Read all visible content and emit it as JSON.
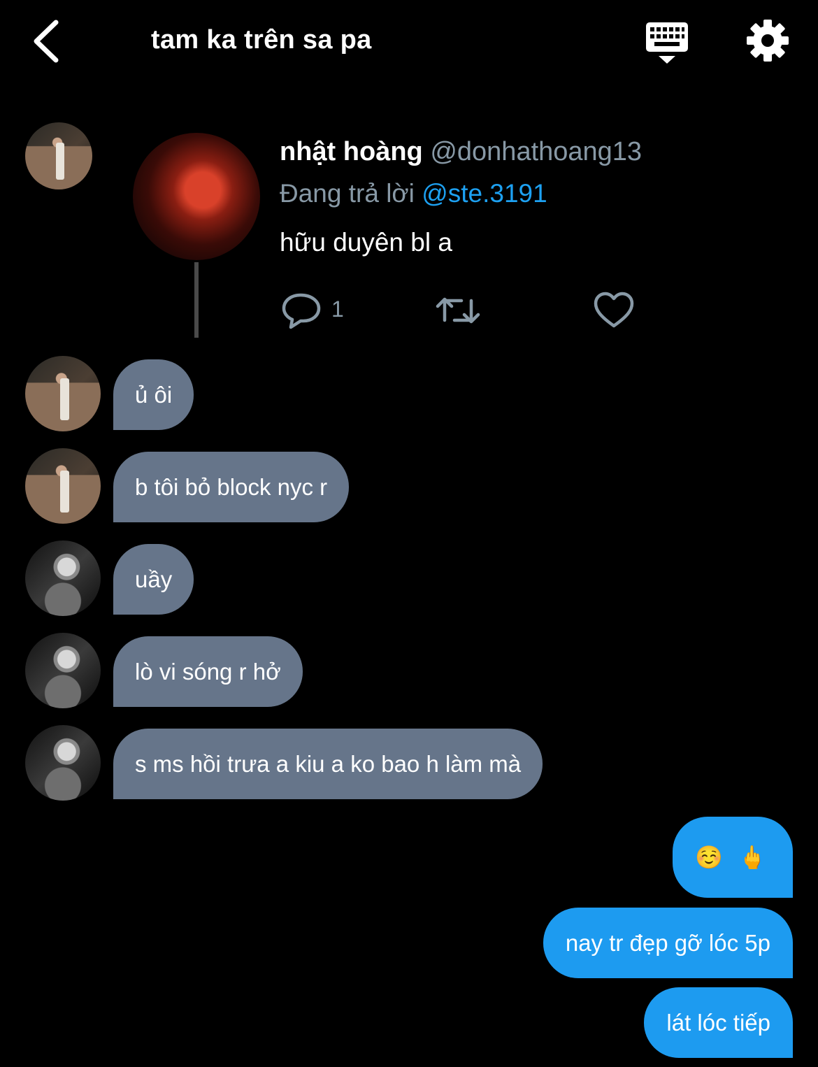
{
  "header": {
    "title": "tam ka trên sa pa",
    "back_icon": "chevron-left-icon",
    "keyboard_icon": "keyboard-icon",
    "settings_icon": "gear-icon"
  },
  "tweet": {
    "display_name": "nhật hoàng",
    "handle": "@donhathoang13",
    "replying_label": "Đang trả lời",
    "replying_to": "@ste.3191",
    "text": "hữu duyên bl a",
    "reply_count": "1",
    "icons": [
      "reply-icon",
      "retweet-icon",
      "heart-icon"
    ]
  },
  "messages": [
    {
      "text": "ủ ôi",
      "from": "them"
    },
    {
      "text": "b tôi bỏ block nyc r",
      "from": "them"
    },
    {
      "text": "uầy",
      "from": "them"
    },
    {
      "text": "lò vi sóng r hở",
      "from": "them"
    },
    {
      "text": "s ms hồi trưa a kiu a ko bao h làm mà",
      "from": "them"
    },
    {
      "text": "☺️ 🖕",
      "from": "me"
    },
    {
      "text": "nay tr đẹp gỡ lóc 5p",
      "from": "me"
    },
    {
      "text": "lát lóc tiếp",
      "from": "me"
    }
  ],
  "colors": {
    "background": "#000000",
    "incoming_bubble": "#66758a",
    "outgoing_bubble": "#1d9bf0",
    "secondary_text": "#8899a6",
    "mention": "#1da1f2"
  }
}
